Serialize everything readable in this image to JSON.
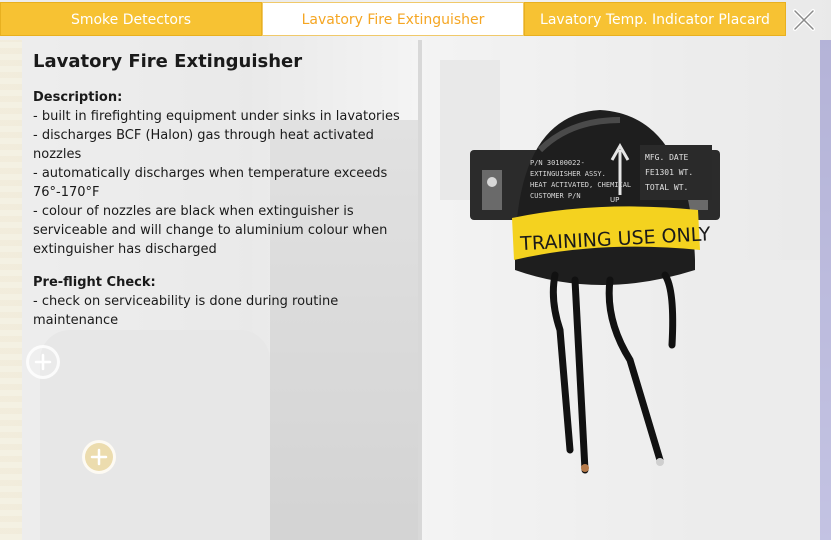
{
  "tabs": [
    {
      "label": "Smoke Detectors",
      "active": false
    },
    {
      "label": "Lavatory Fire Extinguisher",
      "active": true
    },
    {
      "label": "Lavatory Temp. Indicator Placard",
      "active": false
    }
  ],
  "content": {
    "title": "Lavatory Fire Extinguisher",
    "description_label": "Description:",
    "description_lines": [
      "- built in firefighting equipment under sinks in lavatories",
      "- discharges BCF (Halon) gas through heat activated nozzles",
      "- automatically discharges when temperature exceeds 76°-170°F",
      "- colour of nozzles are black when extinguisher is serviceable and will change to aluminium colour when extinguisher has discharged"
    ],
    "preflight_label": "Pre-flight Check:",
    "preflight_lines": [
      "- check on serviceability is done during routine maintenance"
    ]
  },
  "image": {
    "band_text": "TRAINING USE ONLY",
    "label_lines": [
      "P/N 30100022-",
      "EXTINGUISHER ASSY.",
      "HEAT ACTIVATED, CHEMICAL",
      "CUSTOMER P/N"
    ],
    "label_right": [
      "MFG. DATE",
      "FE1301 WT.",
      "TOTAL WT."
    ],
    "arrow_text": "UP"
  },
  "icons": {
    "close": "close-icon",
    "hotspot": "plus-icon"
  },
  "colors": {
    "tab_bg": "#f7c233",
    "tab_active_text": "#f5a623",
    "band": "#f4d21f"
  }
}
